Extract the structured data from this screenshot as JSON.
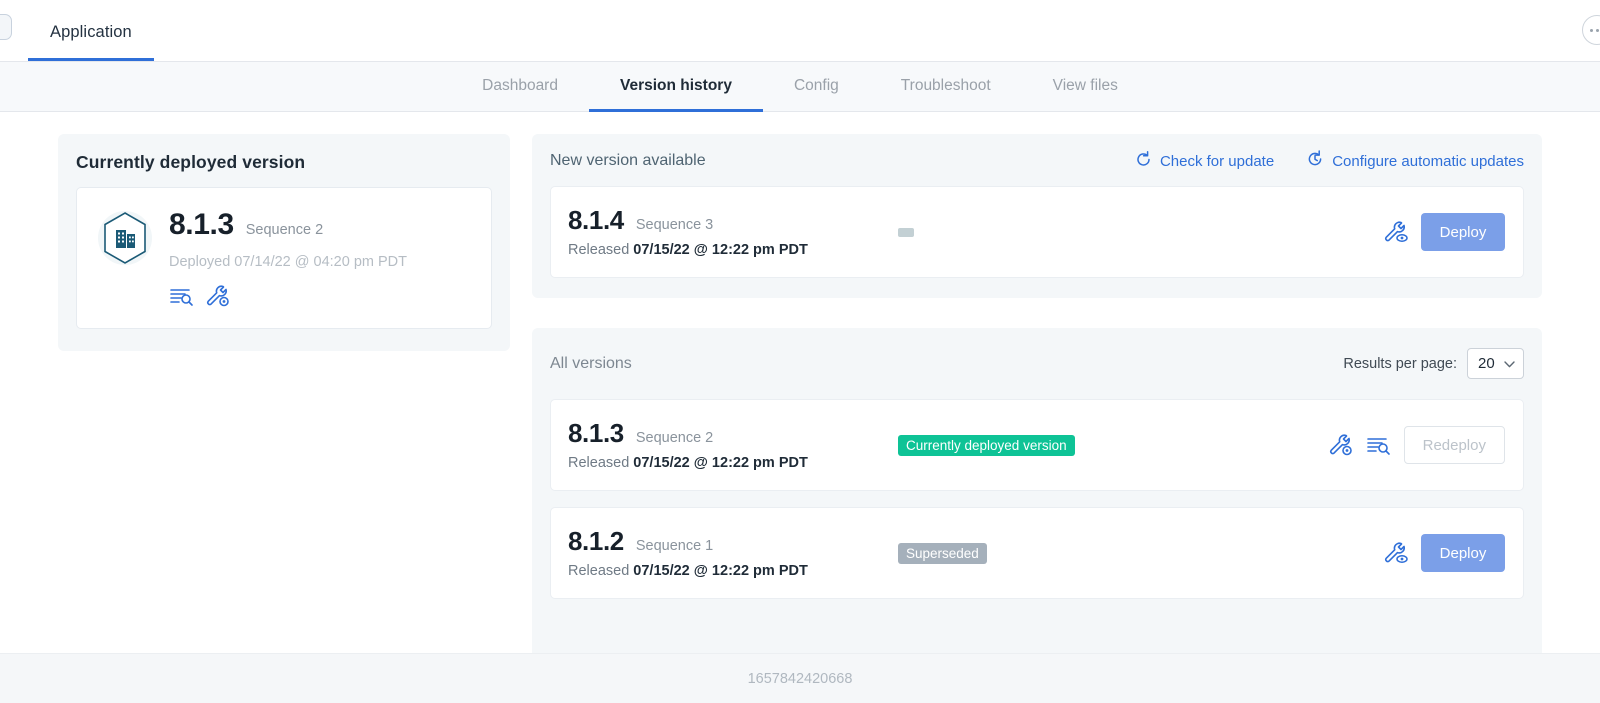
{
  "topbar": {
    "app_tab_label": "Application",
    "logo_icon": "app-logo-icon",
    "overflow_icon": "more-dots-icon"
  },
  "subnav": {
    "items": [
      {
        "label": "Dashboard",
        "active": false
      },
      {
        "label": "Version history",
        "active": true
      },
      {
        "label": "Config",
        "active": false
      },
      {
        "label": "Troubleshoot",
        "active": false
      },
      {
        "label": "View files",
        "active": false
      }
    ]
  },
  "deployed_panel": {
    "title": "Currently deployed version",
    "app_icon": "enterprise-hexagon-icon",
    "version": "8.1.3",
    "sequence": "Sequence 2",
    "deployed_at": "Deployed 07/14/22 @ 04:20 pm PDT",
    "icons": [
      {
        "name": "view-logs-icon"
      },
      {
        "name": "wrench-gear-icon"
      }
    ]
  },
  "new_version": {
    "title": "New version available",
    "actions": [
      {
        "label": "Check for update",
        "icon": "refresh-icon"
      },
      {
        "label": "Configure automatic updates",
        "icon": "clock-update-icon"
      }
    ],
    "card": {
      "version": "8.1.4",
      "sequence": "Sequence 3",
      "released_prefix": "Released ",
      "released_at": "07/15/22 @ 12:22 pm PDT",
      "badge_label": "",
      "badge_type": "blank",
      "icons": [
        {
          "name": "wrench-eye-icon"
        }
      ],
      "button_label": "Deploy",
      "button_state": "enabled"
    }
  },
  "all_versions": {
    "title": "All versions",
    "results_per_page_label": "Results per page:",
    "results_per_page_value": "20",
    "results_per_page_options": [
      "20"
    ],
    "rows": [
      {
        "version": "8.1.3",
        "sequence": "Sequence 2",
        "released_prefix": "Released ",
        "released_at": "07/15/22 @ 12:22 pm PDT",
        "badge_label": "Currently deployed version",
        "badge_type": "deployed",
        "icons": [
          {
            "name": "wrench-gear-icon"
          },
          {
            "name": "view-logs-icon"
          }
        ],
        "button_label": "Redeploy",
        "button_state": "disabled"
      },
      {
        "version": "8.1.2",
        "sequence": "Sequence 1",
        "released_prefix": "Released ",
        "released_at": "07/15/22 @ 12:22 pm PDT",
        "badge_label": "Superseded",
        "badge_type": "superseded",
        "icons": [
          {
            "name": "wrench-eye-icon"
          }
        ],
        "button_label": "Deploy",
        "button_state": "enabled"
      }
    ]
  },
  "footer": {
    "text": "1657842420668"
  },
  "colors": {
    "accent_blue": "#2f6fd8",
    "deploy_button": "#7b9fe8",
    "badge_deployed": "#0ec396",
    "badge_superseded": "#a5b0bb",
    "panel_bg": "#f4f7f9"
  }
}
